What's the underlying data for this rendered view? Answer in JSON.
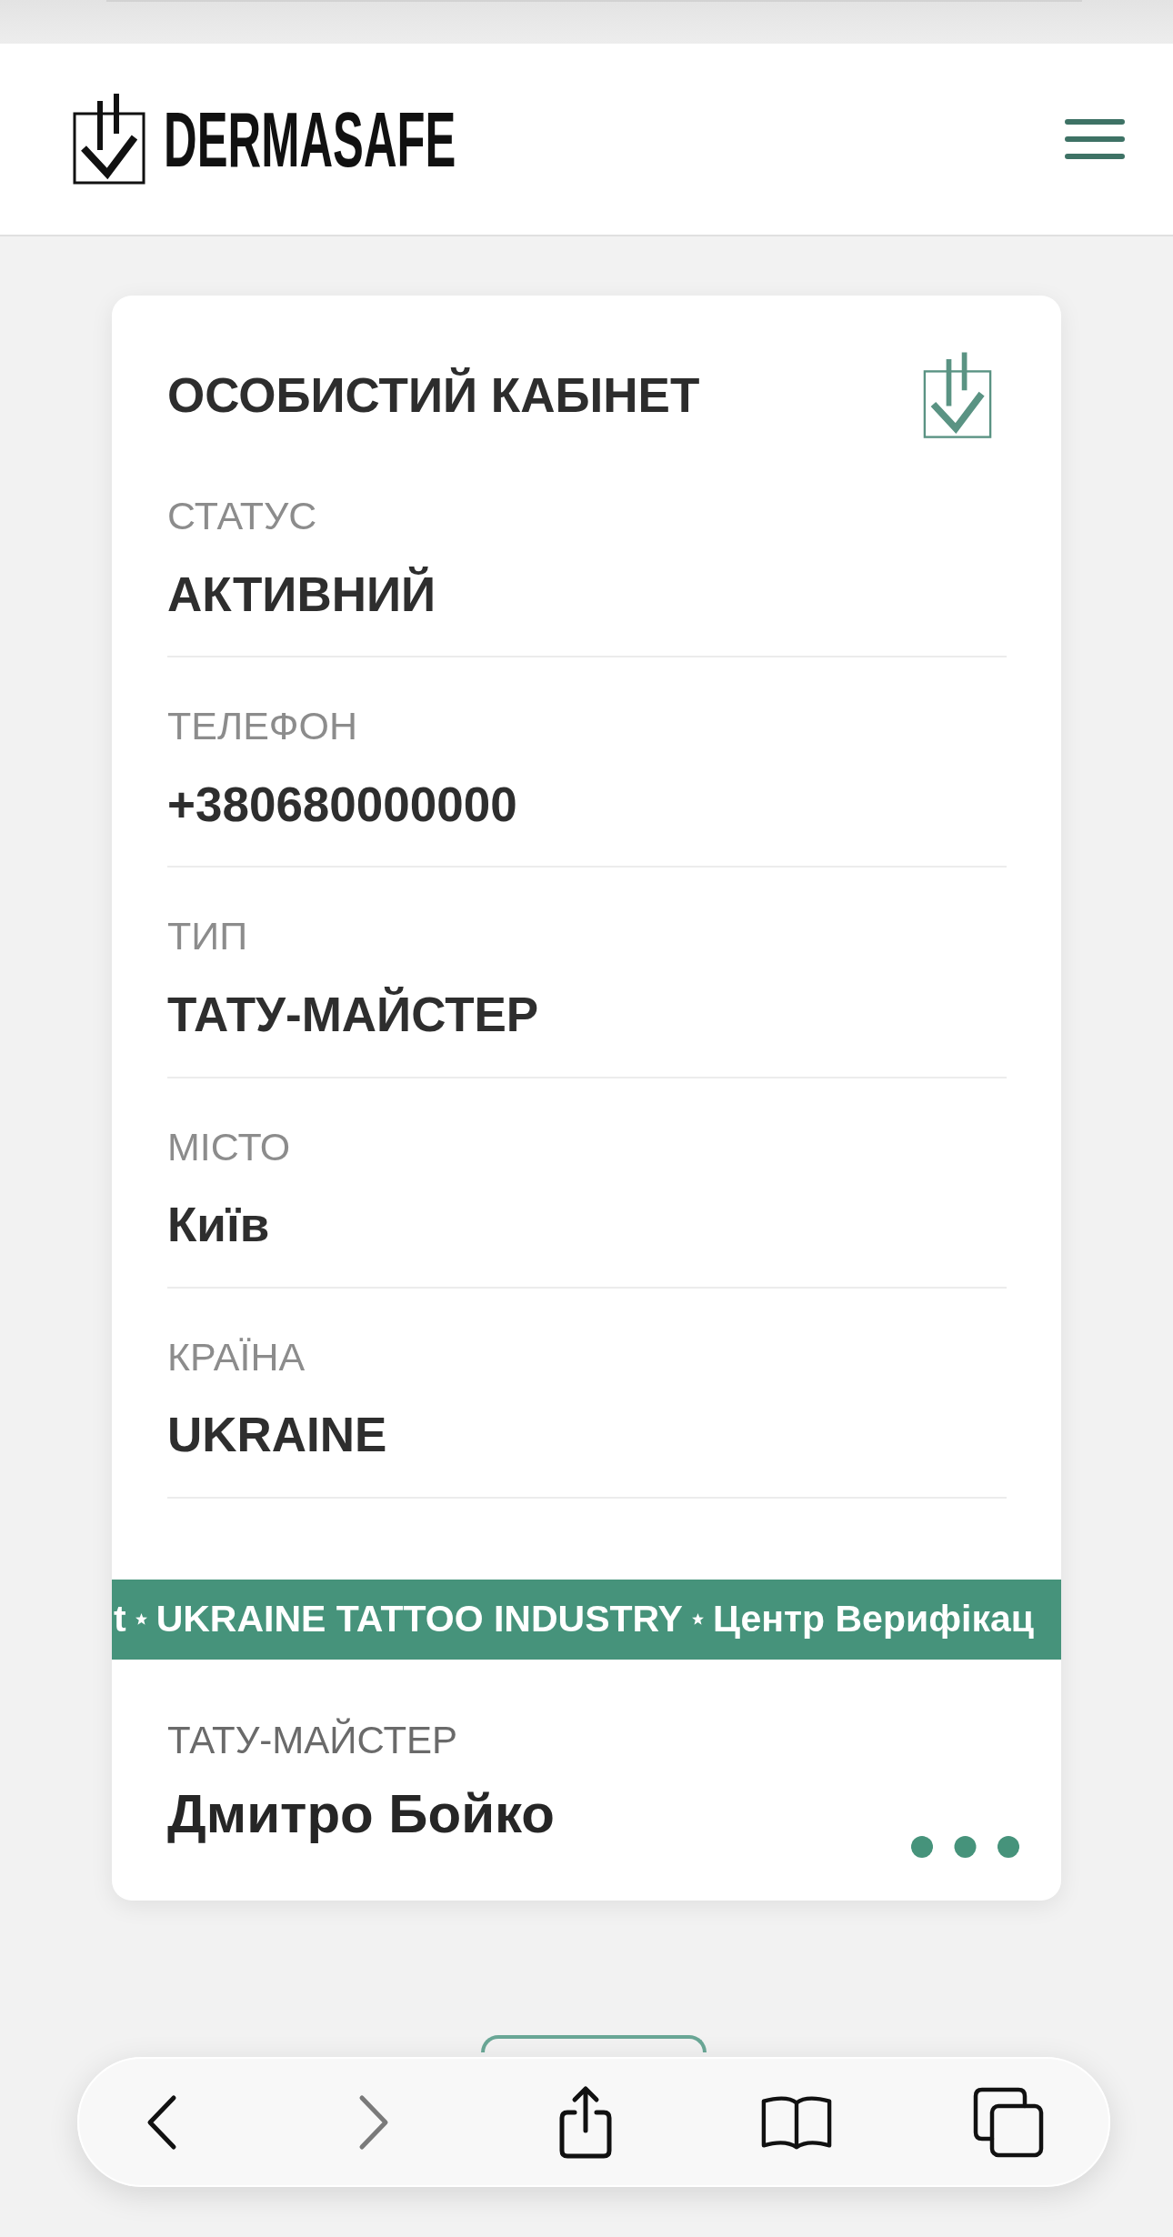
{
  "header": {
    "logo_text": "DERMASAFE"
  },
  "card": {
    "title": "ОСОБИСТИЙ КАБІНЕТ",
    "fields": [
      {
        "label": "СТАТУС",
        "value": "АКТИВНИЙ"
      },
      {
        "label": "ТЕЛЕФОН",
        "value": "+380680000000"
      },
      {
        "label": "ТИП",
        "value": "ТАТУ-МАЙСТЕР"
      },
      {
        "label": "МІСТО",
        "value": "Київ"
      },
      {
        "label": "КРАЇНА",
        "value": "UKRAINE"
      }
    ],
    "ticker": [
      "t",
      "UKRAINE TATTOO INDUSTRY",
      "Центр Верифікац"
    ],
    "profile": {
      "role": "ТАТУ-МАЙСТЕР",
      "name": "Дмитро Бойко"
    }
  },
  "browser_toolbar": {
    "buttons": [
      {
        "kind": "back",
        "disabled": false
      },
      {
        "kind": "forward",
        "disabled": true
      },
      {
        "kind": "share",
        "disabled": false
      },
      {
        "kind": "bookmarks",
        "disabled": false
      },
      {
        "kind": "tabs",
        "disabled": false
      }
    ]
  }
}
